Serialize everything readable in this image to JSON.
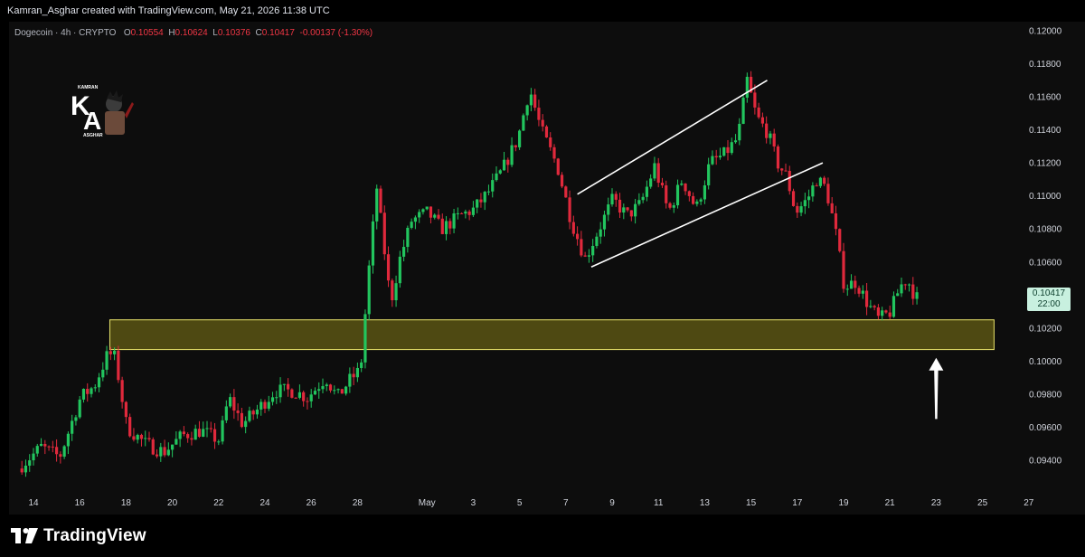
{
  "header": {
    "author_line": "Kamran_Asghar created with TradingView.com, May 21, 2026 11:38 UTC"
  },
  "legend": {
    "symbol": "Dogecoin · 4h · CRYPTO",
    "o_label": "O",
    "o_value": "0.10554",
    "h_label": "H",
    "h_value": "0.10624",
    "l_label": "L",
    "l_value": "0.10376",
    "c_label": "C",
    "c_value": "0.10417",
    "change": "-0.00137 (-1.30%)"
  },
  "logo": {
    "letters": "KA",
    "top_text": "KAMRAN",
    "bottom_text": "ASGHAR"
  },
  "price_badge": {
    "price": "0.10417",
    "countdown": "22:00"
  },
  "footer": {
    "brand": "TradingView"
  },
  "colors": {
    "background": "#0d0d0d",
    "up": "#22c55e",
    "down": "#e0293c",
    "zone_fill": "#5a5514",
    "zone_border": "#e8e36b",
    "trendline": "#ffffff",
    "axis_text": "#d1d4dc"
  },
  "chart_data": {
    "type": "candlestick",
    "title": "Dogecoin · 4h · CRYPTO",
    "timeframe": "4h",
    "y_axis": {
      "ticks": [
        "0.12000",
        "0.11800",
        "0.11600",
        "0.11400",
        "0.11200",
        "0.11000",
        "0.10800",
        "0.10600",
        "0.10400",
        "0.10200",
        "0.10000",
        "0.09800",
        "0.09600",
        "0.09400"
      ],
      "range": [
        0.0922,
        0.121
      ]
    },
    "x_axis": {
      "ticks": [
        "14",
        "16",
        "18",
        "20",
        "22",
        "24",
        "26",
        "28",
        "May",
        "3",
        "5",
        "7",
        "9",
        "11",
        "13",
        "15",
        "17",
        "19",
        "21",
        "23",
        "25",
        "27"
      ],
      "tick_day_index": [
        14,
        16,
        18,
        20,
        22,
        24,
        26,
        28,
        31,
        33,
        35,
        37,
        39,
        41,
        43,
        45,
        47,
        49,
        51,
        53,
        55,
        57
      ],
      "range_days": [
        13.0,
        58.3
      ]
    },
    "support_zone": {
      "low": 0.1007,
      "high": 0.1025,
      "from_day": 17.3,
      "to_day": 55.5
    },
    "trendlines": [
      {
        "name": "channel upper",
        "from": {
          "day": 37.5,
          "price": 0.1101
        },
        "to": {
          "day": 45.7,
          "price": 0.117
        }
      },
      {
        "name": "channel lower",
        "from": {
          "day": 38.1,
          "price": 0.1057
        },
        "to": {
          "day": 48.1,
          "price": 0.112
        }
      }
    ],
    "arrow": {
      "day": 53.0,
      "from_price": 0.0965,
      "to_price": 0.1002,
      "direction": "up"
    },
    "anchors": [
      [
        13.5,
        0.0935
      ],
      [
        14.5,
        0.0948
      ],
      [
        15.3,
        0.0942
      ],
      [
        16.2,
        0.0978
      ],
      [
        16.8,
        0.0985
      ],
      [
        17.4,
        0.1005
      ],
      [
        17.7,
        0.1002
      ],
      [
        18.2,
        0.096
      ],
      [
        19.0,
        0.095
      ],
      [
        19.8,
        0.0945
      ],
      [
        20.6,
        0.0955
      ],
      [
        21.4,
        0.0958
      ],
      [
        22.2,
        0.0952
      ],
      [
        22.6,
        0.0978
      ],
      [
        23.2,
        0.0962
      ],
      [
        23.8,
        0.097
      ],
      [
        24.6,
        0.0982
      ],
      [
        25.4,
        0.0982
      ],
      [
        26.0,
        0.0978
      ],
      [
        26.8,
        0.099
      ],
      [
        27.3,
        0.0978
      ],
      [
        27.8,
        0.0988
      ],
      [
        28.3,
        0.0995
      ],
      [
        28.7,
        0.1062
      ],
      [
        29.0,
        0.1105
      ],
      [
        29.6,
        0.1035
      ],
      [
        30.0,
        0.1062
      ],
      [
        30.5,
        0.1085
      ],
      [
        31.2,
        0.109
      ],
      [
        31.8,
        0.108
      ],
      [
        32.6,
        0.1088
      ],
      [
        33.2,
        0.1092
      ],
      [
        33.8,
        0.1102
      ],
      [
        34.4,
        0.1115
      ],
      [
        35.1,
        0.1135
      ],
      [
        35.6,
        0.1165
      ],
      [
        36.1,
        0.114
      ],
      [
        36.8,
        0.1118
      ],
      [
        37.4,
        0.1085
      ],
      [
        38.0,
        0.1062
      ],
      [
        38.6,
        0.108
      ],
      [
        39.2,
        0.1098
      ],
      [
        39.8,
        0.1088
      ],
      [
        40.4,
        0.1095
      ],
      [
        41.0,
        0.1118
      ],
      [
        41.6,
        0.109
      ],
      [
        42.2,
        0.111
      ],
      [
        42.8,
        0.1092
      ],
      [
        43.4,
        0.112
      ],
      [
        44.0,
        0.1125
      ],
      [
        44.6,
        0.1135
      ],
      [
        45.0,
        0.117
      ],
      [
        45.4,
        0.1148
      ],
      [
        45.9,
        0.1138
      ],
      [
        46.3,
        0.112
      ],
      [
        46.7,
        0.1112
      ],
      [
        47.1,
        0.109
      ],
      [
        47.6,
        0.1098
      ],
      [
        48.0,
        0.111
      ],
      [
        48.4,
        0.1105
      ],
      [
        48.8,
        0.108
      ],
      [
        49.2,
        0.1045
      ],
      [
        49.7,
        0.1048
      ],
      [
        50.2,
        0.1035
      ],
      [
        50.7,
        0.1025
      ],
      [
        51.2,
        0.103
      ],
      [
        51.6,
        0.1045
      ],
      [
        51.9,
        0.105
      ],
      [
        52.2,
        0.1041
      ]
    ],
    "last_price": 0.10417
  }
}
